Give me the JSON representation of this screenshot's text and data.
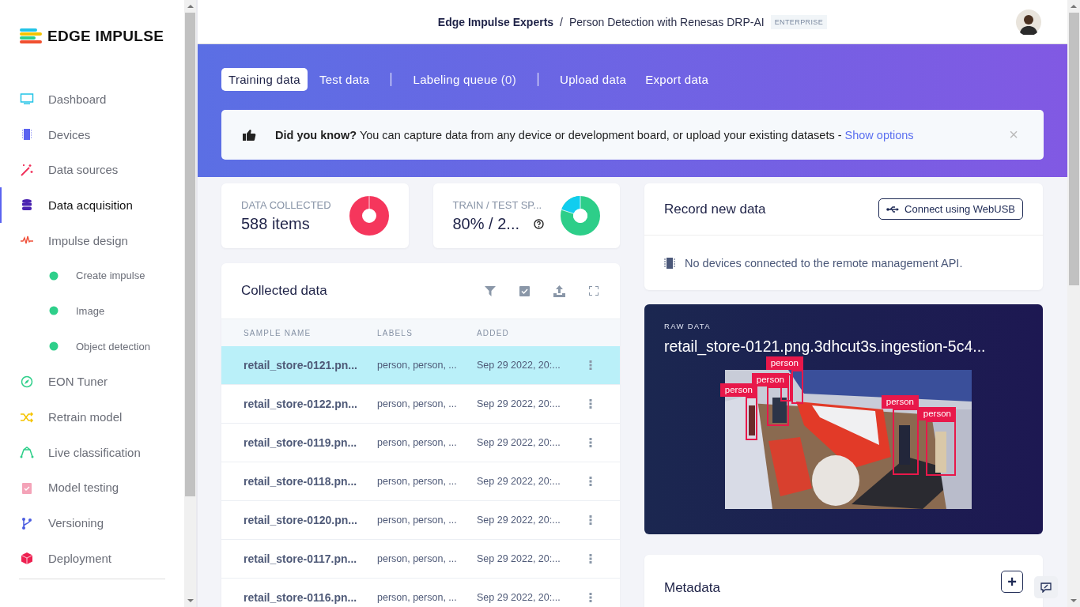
{
  "brand": {
    "name": "EDGE IMPULSE"
  },
  "sidebar": {
    "items": [
      {
        "label": "Dashboard",
        "selected": false
      },
      {
        "label": "Devices",
        "selected": false
      },
      {
        "label": "Data sources",
        "selected": false
      },
      {
        "label": "Data acquisition",
        "selected": true
      },
      {
        "label": "Impulse design",
        "selected": false,
        "children": [
          {
            "label": "Create impulse",
            "selected": false
          },
          {
            "label": "Image",
            "selected": false
          },
          {
            "label": "Object detection",
            "selected": false
          }
        ]
      },
      {
        "label": "EON Tuner",
        "selected": false
      },
      {
        "label": "Retrain model",
        "selected": false
      },
      {
        "label": "Live classification",
        "selected": false
      },
      {
        "label": "Model testing",
        "selected": false
      },
      {
        "label": "Versioning",
        "selected": false
      },
      {
        "label": "Deployment",
        "selected": false
      }
    ]
  },
  "header": {
    "organization": "Edge Impulse Experts",
    "separator": "/",
    "project": "Person Detection with Renesas DRP-AI",
    "badge": "ENTERPRISE"
  },
  "tabs": [
    {
      "label": "Training data",
      "selected": true,
      "divider_before": false
    },
    {
      "label": "Test data",
      "selected": false,
      "divider_before": false
    },
    {
      "label": "Labeling queue",
      "count": "(0)",
      "selected": false,
      "divider_before": true
    },
    {
      "label": "Upload data",
      "selected": false,
      "divider_before": true
    },
    {
      "label": "Export data",
      "selected": false,
      "divider_before": false
    }
  ],
  "banner": {
    "text": "**Did you know?** You can capture data from any device or development board, or upload your existing datasets - ",
    "link": "Show options",
    "close": "×"
  },
  "stats": [
    {
      "title": "DATA COLLECTED",
      "value": "588 items",
      "help": false
    },
    {
      "title": "TRAIN / TEST SP...",
      "value": "80% / 2...",
      "help": true
    }
  ],
  "collected_data": {
    "title": "Collected data",
    "columns": [
      "SAMPLE NAME",
      "LABELS",
      "ADDED"
    ],
    "rows": [
      {
        "name": "retail_store-0121.pn...",
        "labels": "person, person, ...",
        "added": "Sep 29 2022, 20:...",
        "selected": true
      },
      {
        "name": "retail_store-0122.pn...",
        "labels": "person, person, ...",
        "added": "Sep 29 2022, 20:...",
        "selected": false
      },
      {
        "name": "retail_store-0119.pn...",
        "labels": "person, person, ...",
        "added": "Sep 29 2022, 20:...",
        "selected": false
      },
      {
        "name": "retail_store-0118.pn...",
        "labels": "person, person, ...",
        "added": "Sep 29 2022, 20:...",
        "selected": false
      },
      {
        "name": "retail_store-0120.pn...",
        "labels": "person, person, ...",
        "added": "Sep 29 2022, 20:...",
        "selected": false
      },
      {
        "name": "retail_store-0117.pn...",
        "labels": "person, person, ...",
        "added": "Sep 29 2022, 20:...",
        "selected": false
      },
      {
        "name": "retail_store-0116.pn...",
        "labels": "person, person, ...",
        "added": "Sep 29 2022, 20:...",
        "selected": false
      }
    ]
  },
  "record": {
    "title": "Record new data",
    "button": "Connect using WebUSB",
    "message": "No devices connected to the remote management API."
  },
  "raw_data": {
    "caption": "RAW DATA",
    "title": "retail_store-0121.png.3dhcut3s.ingestion-5c4...",
    "boxes": [
      {
        "kind": "labeled",
        "label": "person"
      },
      {
        "kind": "labeled",
        "label": "person"
      },
      {
        "kind": "unlabeled"
      },
      {
        "kind": "labeled",
        "label": "person"
      },
      {
        "kind": "labeled",
        "label": "person"
      },
      {
        "kind": "labeled",
        "label": "person"
      }
    ]
  },
  "metadata": {
    "title": "Metadata",
    "add": "+"
  }
}
